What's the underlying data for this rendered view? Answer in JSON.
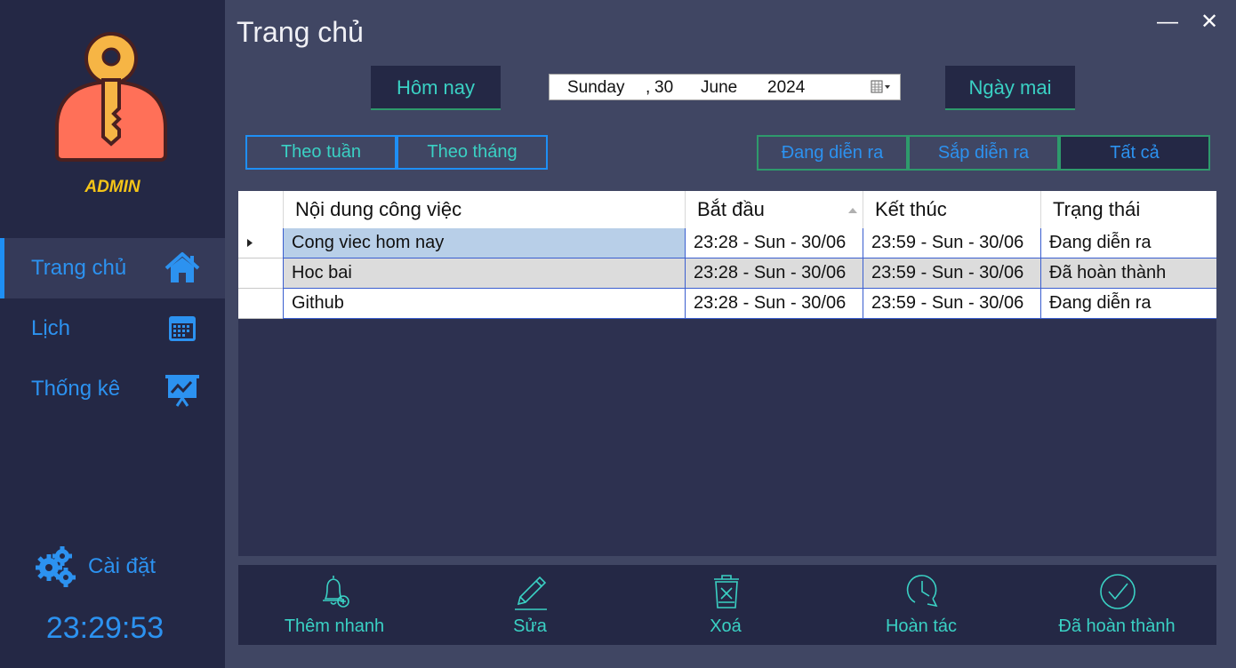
{
  "window": {
    "title": "Trang chủ",
    "minimize_glyph": "—",
    "close_glyph": "✕"
  },
  "sidebar": {
    "user_label": "ADMIN",
    "avatar_icon": "key-person-icon",
    "items": [
      {
        "label": "Trang chủ",
        "icon": "home-icon",
        "active": true
      },
      {
        "label": "Lịch",
        "icon": "calendar-icon",
        "active": false
      },
      {
        "label": "Thống kê",
        "icon": "presentation-chart-icon",
        "active": false
      }
    ],
    "settings_label": "Cài đặt",
    "settings_icon": "gears-icon",
    "clock": "23:29:53"
  },
  "date_nav": {
    "today_label": "Hôm nay",
    "tomorrow_label": "Ngày mai",
    "date": {
      "weekday": "Sunday",
      "sep": ",",
      "day": "30",
      "month": "June",
      "year": "2024"
    }
  },
  "view_filters": {
    "week_label": "Theo tuần",
    "month_label": "Theo tháng"
  },
  "status_filters": {
    "ongoing_label": "Đang diễn ra",
    "upcoming_label": "Sắp diễn ra",
    "all_label": "Tất cả",
    "selected": "all"
  },
  "table": {
    "columns": [
      "Nội dung công việc",
      "Bắt đầu",
      "Kết thúc",
      "Trạng thái"
    ],
    "rows": [
      {
        "content": "Cong viec hom nay",
        "start": "23:28 - Sun - 30/06",
        "end": "23:59 - Sun - 30/06",
        "status": "Đang diễn ra"
      },
      {
        "content": "Hoc bai",
        "start": "23:28 - Sun - 30/06",
        "end": "23:59 - Sun - 30/06",
        "status": "Đã hoàn thành"
      },
      {
        "content": "Github",
        "start": "23:28 - Sun - 30/06",
        "end": "23:59 - Sun - 30/06",
        "status": "Đang diễn ra"
      }
    ]
  },
  "toolbar": {
    "quick_add_label": "Thêm nhanh",
    "edit_label": "Sửa",
    "delete_label": "Xoá",
    "undo_label": "Hoàn tác",
    "done_label": "Đã hoàn thành"
  },
  "colors": {
    "sidebar_bg": "#242845",
    "main_bg": "#404663",
    "accent_blue": "#2c92f0",
    "accent_teal": "#3ad1c4",
    "admin_yellow": "#f5c518",
    "selected_row": "#b8cfe8",
    "alt_row": "#dcdcdc"
  }
}
